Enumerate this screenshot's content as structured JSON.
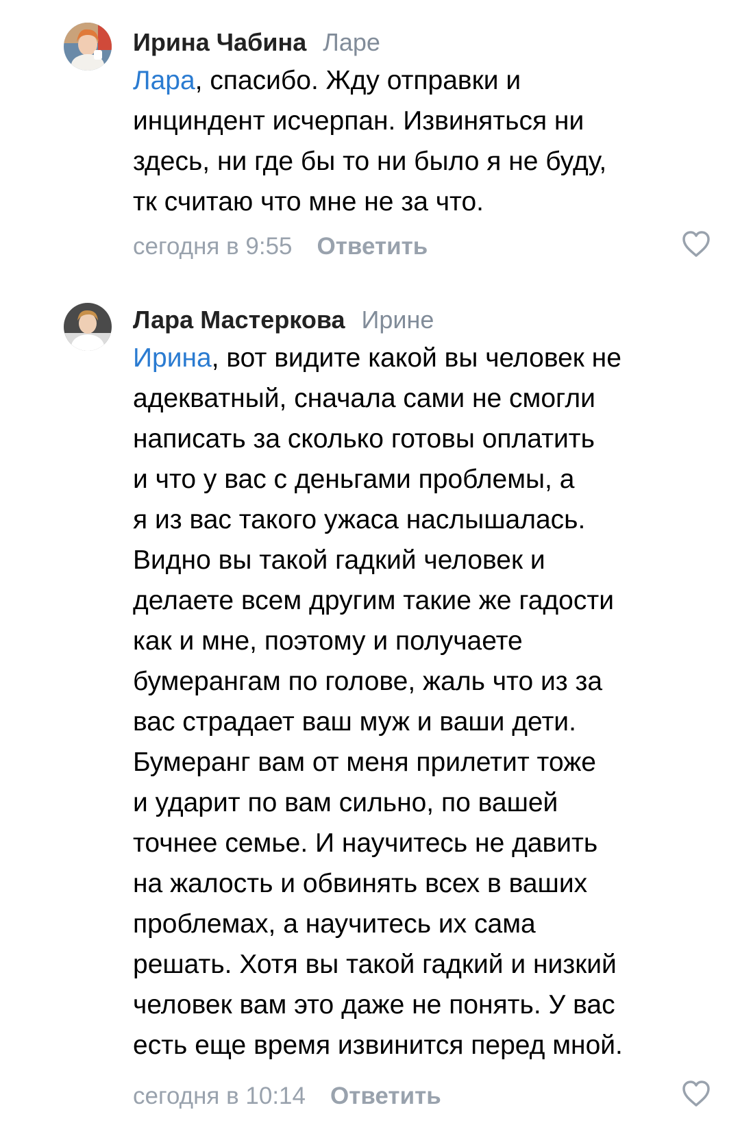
{
  "comments": [
    {
      "author": "Ирина Чабина",
      "reply_to": "Ларе",
      "mention": "Лара",
      "lines": [
        ", спасибо. Жду отправки и",
        "инциндент исчерпан. Извиняться ни",
        "здесь, ни где бы то ни было я не буду,",
        "тк считаю что мне не за что."
      ],
      "timestamp": "сегодня в 9:55",
      "reply_label": "Ответить",
      "like_icon": "heart-outline-icon"
    },
    {
      "author": "Лара Мастеркова",
      "reply_to": "Ирине",
      "mention": "Ирина",
      "lines": [
        ", вот видите какой вы человек не",
        "адекватный, сначала сами не смогли",
        "написать за сколько готовы оплатить",
        "и что у вас с деньгами проблемы, а",
        "я из вас такого ужаса наслышалась.",
        "Видно вы такой гадкий человек и",
        "делаете всем другим такие же гадости",
        "как и мне, поэтому и получаете",
        "бумерангам по голове, жаль что из за",
        "вас страдает ваш муж и ваши дети.",
        "Бумеранг вам от меня прилетит тоже",
        "и ударит по вам сильно, по вашей",
        "точнее семье. И научитесь не давить",
        "на жалость и обвинять всех в ваших",
        "проблемах, а научитесь их сама",
        "решать. Хотя вы такой гадкий и низкий",
        "человек вам это даже не понять. У вас",
        "есть еще время извинится перед мной."
      ],
      "timestamp": "сегодня в 10:14",
      "reply_label": "Ответить",
      "like_icon": "heart-outline-icon"
    }
  ],
  "colors": {
    "mention": "#2a7bd1",
    "secondary": "#818c99",
    "meta": "#99a2ad",
    "text": "#000000"
  }
}
